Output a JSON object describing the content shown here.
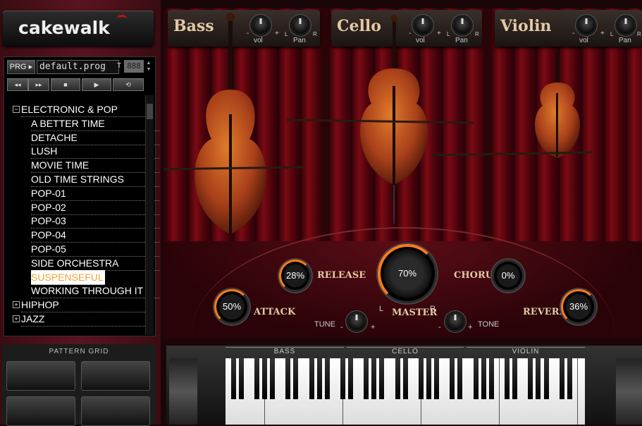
{
  "app": {
    "logo": "cakewalk"
  },
  "browser": {
    "prg_button": "PRG ▸",
    "program_name": "default.prog",
    "t_label": "T",
    "lcd": "888",
    "transport": [
      "◂◂",
      "▸▸",
      "■",
      "▶",
      "⟲"
    ],
    "tree": [
      {
        "label": "ELECTRONIC & POP",
        "type": "folder",
        "expanded": true,
        "pm": "−"
      },
      {
        "label": "A BETTER TIME",
        "type": "item"
      },
      {
        "label": "DETACHE",
        "type": "item"
      },
      {
        "label": "LUSH",
        "type": "item"
      },
      {
        "label": "MOVIE TIME",
        "type": "item"
      },
      {
        "label": "OLD TIME STRINGS",
        "type": "item"
      },
      {
        "label": "POP-01",
        "type": "item"
      },
      {
        "label": "POP-02",
        "type": "item"
      },
      {
        "label": "POP-03",
        "type": "item"
      },
      {
        "label": "POP-04",
        "type": "item"
      },
      {
        "label": "POP-05",
        "type": "item"
      },
      {
        "label": "SIDE ORCHESTRA",
        "type": "item"
      },
      {
        "label": "SUSPENSEFUL",
        "type": "item",
        "selected": true
      },
      {
        "label": "WORKING THROUGH IT",
        "type": "item"
      },
      {
        "label": "HIPHOP",
        "type": "folder",
        "pm": "+"
      },
      {
        "label": "JAZZ",
        "type": "folder",
        "pm": "+"
      }
    ]
  },
  "pattern_grid": {
    "title": "PATTERN GRID"
  },
  "instruments": [
    {
      "name": "Bass",
      "vol": "vol",
      "pan": "Pan",
      "minus": "-",
      "plus": "+",
      "l": "L",
      "r": "R"
    },
    {
      "name": "Cello",
      "vol": "vol",
      "pan": "Pan",
      "minus": "-",
      "plus": "+",
      "l": "L",
      "r": "R"
    },
    {
      "name": "Violin",
      "vol": "vol",
      "pan": "Pan",
      "minus": "-",
      "plus": "+",
      "l": "L",
      "r": "R"
    }
  ],
  "controls": {
    "release": {
      "label": "RELEASE",
      "value": "28%"
    },
    "attack": {
      "label": "ATTACK",
      "value": "50%"
    },
    "master": {
      "label": "MASTER",
      "value": "70%",
      "l": "L",
      "r": "R"
    },
    "chorus": {
      "label": "CHORUS",
      "value": "0%"
    },
    "reverb": {
      "label": "REVERB",
      "value": "36%"
    },
    "tune": {
      "label": "TUNE",
      "minus": "-",
      "plus": "+"
    },
    "tone": {
      "label": "TONE",
      "minus": "-",
      "plus": "+"
    }
  },
  "keyboard": {
    "zones": [
      "BASS",
      "CELLO",
      "VIOLIN"
    ]
  },
  "colors": {
    "accent": "#ff7a1a",
    "selected_text": "#f0a53a",
    "curtain": "#7a0a14"
  }
}
